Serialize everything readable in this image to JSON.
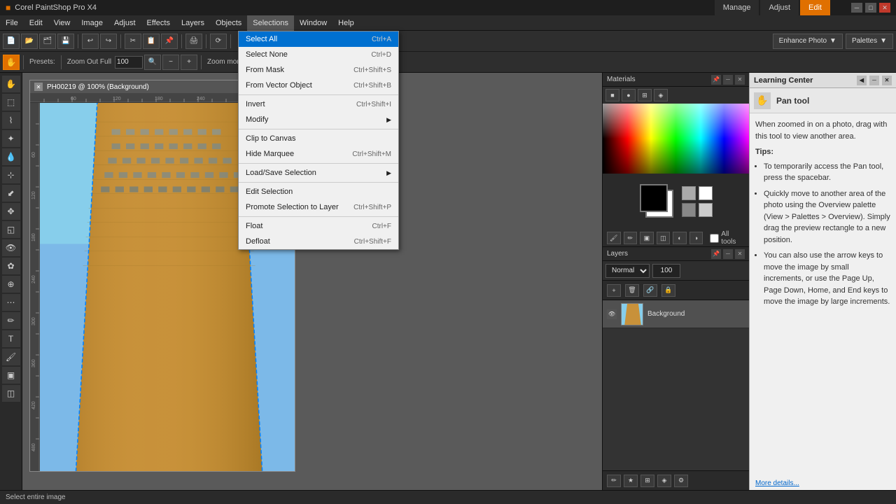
{
  "titleBar": {
    "appName": "Corel PaintShop Pro X4",
    "controls": [
      "minimize",
      "restore",
      "close"
    ]
  },
  "menuBar": {
    "items": [
      {
        "id": "file",
        "label": "File"
      },
      {
        "id": "edit",
        "label": "Edit"
      },
      {
        "id": "view",
        "label": "View"
      },
      {
        "id": "image",
        "label": "Image"
      },
      {
        "id": "adjust",
        "label": "Adjust"
      },
      {
        "id": "effects",
        "label": "Effects"
      },
      {
        "id": "layers",
        "label": "Layers"
      },
      {
        "id": "objects",
        "label": "Objects"
      },
      {
        "id": "selections",
        "label": "Selections",
        "active": true
      },
      {
        "id": "window",
        "label": "Window"
      },
      {
        "id": "help",
        "label": "Help"
      }
    ]
  },
  "topTabs": {
    "tabs": [
      {
        "id": "manage",
        "label": "Manage"
      },
      {
        "id": "adjust",
        "label": "Adjust"
      },
      {
        "id": "edit",
        "label": "Edit",
        "active": true
      }
    ]
  },
  "toolbar": {
    "presets_label": "Presets:",
    "zoom_out_label": "Zoom Out Full",
    "zoom_val": "100",
    "zoom_more_label": "Zoom more:",
    "enhance_label": "Enhance Photo",
    "palettes_label": "Palettes"
  },
  "selectionsMenu": {
    "items": [
      {
        "id": "select-all",
        "label": "Select All",
        "shortcut": "Ctrl+A",
        "highlighted": true
      },
      {
        "id": "select-none",
        "label": "Select None",
        "shortcut": "Ctrl+D"
      },
      {
        "id": "from-mask",
        "label": "From Mask",
        "shortcut": "Ctrl+Shift+S"
      },
      {
        "id": "from-vector",
        "label": "From Vector Object",
        "shortcut": "Ctrl+Shift+B"
      },
      {
        "separator": true
      },
      {
        "id": "invert",
        "label": "Invert",
        "shortcut": "Ctrl+Shift+I"
      },
      {
        "id": "modify",
        "label": "Modify",
        "shortcut": "",
        "hasSubmenu": true
      },
      {
        "separator": true
      },
      {
        "id": "clip-canvas",
        "label": "Clip to Canvas",
        "shortcut": ""
      },
      {
        "id": "hide-marquee",
        "label": "Hide Marquee",
        "shortcut": "Ctrl+Shift+M"
      },
      {
        "separator": true
      },
      {
        "id": "load-save",
        "label": "Load/Save Selection",
        "shortcut": "",
        "hasSubmenu": true
      },
      {
        "separator": true
      },
      {
        "id": "edit-selection",
        "label": "Edit Selection",
        "shortcut": ""
      },
      {
        "id": "promote-layer",
        "label": "Promote Selection to Layer",
        "shortcut": "Ctrl+Shift+P"
      },
      {
        "separator": true
      },
      {
        "id": "float",
        "label": "Float",
        "shortcut": "Ctrl+F"
      },
      {
        "id": "defloat",
        "label": "Defloat",
        "shortcut": "Ctrl+Shift+F"
      }
    ]
  },
  "canvasWindow": {
    "title": "PH00219 @ 100% (Background)",
    "zoom": "100%"
  },
  "materialsPanel": {
    "title": "Materials",
    "tabs": [
      "square",
      "circle",
      "grid",
      "gradient"
    ]
  },
  "layersPanel": {
    "title": "Layers",
    "blendMode": "Normal",
    "opacity": "100",
    "layers": [
      {
        "name": "Background",
        "visible": true,
        "active": true
      }
    ]
  },
  "learningCenter": {
    "title": "Learning Center",
    "toolName": "Pan tool",
    "description": "When zoomed in on a photo, drag with this tool to view another area.",
    "tipsLabel": "Tips:",
    "tips": [
      "To temporarily access the Pan tool, press the spacebar.",
      "Quickly move to another area of the photo using the Overview palette (View > Palettes > Overview). Simply drag the preview rectangle to a new position.",
      "You can also use the arrow keys to move the image by small increments, or use the Page Up, Page Down, Home, and End keys to move the image by large increments."
    ],
    "moreDetails": "More details..."
  },
  "statusBar": {
    "text": "Select entire image"
  }
}
